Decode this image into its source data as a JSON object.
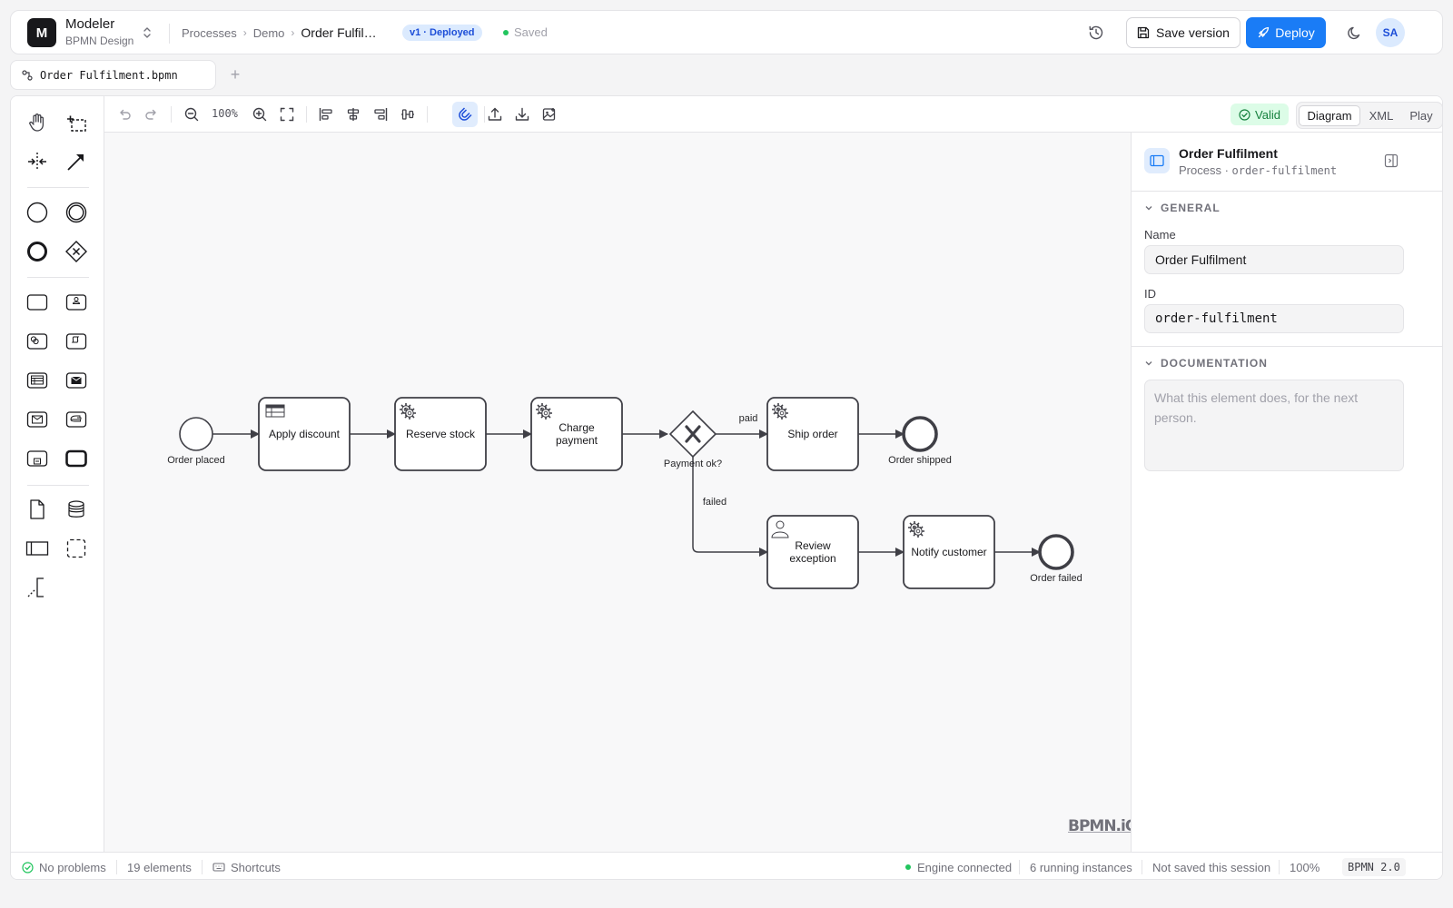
{
  "app": {
    "logo_letter": "M",
    "name": "Modeler",
    "subtitle": "BPMN Design"
  },
  "breadcrumb": [
    "Processes",
    "Demo",
    "Order Fulfil…"
  ],
  "version_badge": "v1 · Deployed",
  "save_state": "Saved",
  "header_actions": {
    "save_version": "Save version",
    "deploy": "Deploy",
    "avatar": "SA"
  },
  "tabs": [
    {
      "label": "Order Fulfilment.bpmn",
      "icon": "process-icon"
    }
  ],
  "add_tab": "+",
  "toolbar": {
    "zoom": "100%",
    "valid": "Valid",
    "views": [
      "Diagram",
      "XML",
      "Play"
    ],
    "active_view": "Diagram"
  },
  "palette": {
    "tools": [
      "hand-tool",
      "lasso-tool",
      "space-tool",
      "connect-tool"
    ],
    "events": [
      "start-event",
      "intermediate-event",
      "end-event",
      "gateway"
    ],
    "tasks": [
      "task",
      "user-task",
      "service-task",
      "script-task",
      "business-rule-task",
      "send-task",
      "receive-task",
      "manual-task",
      "subprocess",
      "call-activity"
    ],
    "data": [
      "data-object",
      "data-store",
      "pool",
      "group",
      "annotation"
    ]
  },
  "diagram": {
    "nodes": [
      {
        "id": "start",
        "type": "start-event",
        "label": "Order placed"
      },
      {
        "id": "discount",
        "type": "business-rule-task",
        "label": "Apply discount"
      },
      {
        "id": "reserve",
        "type": "service-task",
        "label": "Reserve stock"
      },
      {
        "id": "charge",
        "type": "service-task",
        "label": "Charge payment"
      },
      {
        "id": "gw",
        "type": "exclusive-gateway",
        "label": "Payment ok?"
      },
      {
        "id": "ship",
        "type": "service-task",
        "label": "Ship order"
      },
      {
        "id": "end_shipped",
        "type": "end-event",
        "label": "Order shipped"
      },
      {
        "id": "review",
        "type": "user-task",
        "label": "Review exception"
      },
      {
        "id": "notify",
        "type": "service-task",
        "label": "Notify customer"
      },
      {
        "id": "end_failed",
        "type": "end-event",
        "label": "Order failed"
      }
    ],
    "flows": [
      {
        "from": "start",
        "to": "discount",
        "label": ""
      },
      {
        "from": "discount",
        "to": "reserve",
        "label": ""
      },
      {
        "from": "reserve",
        "to": "charge",
        "label": ""
      },
      {
        "from": "charge",
        "to": "gw",
        "label": ""
      },
      {
        "from": "gw",
        "to": "ship",
        "label": "paid"
      },
      {
        "from": "ship",
        "to": "end_shipped",
        "label": ""
      },
      {
        "from": "gw",
        "to": "review",
        "label": "failed"
      },
      {
        "from": "review",
        "to": "notify",
        "label": ""
      },
      {
        "from": "notify",
        "to": "end_failed",
        "label": ""
      }
    ]
  },
  "watermark": "BPMN.iO",
  "properties": {
    "title": "Order Fulfilment",
    "type": "Process",
    "sep": " · ",
    "element_id": "order-fulfilment",
    "general_section": "GENERAL",
    "name_label": "Name",
    "name_value": "Order Fulfilment",
    "id_label": "ID",
    "id_value": "order-fulfilment",
    "doc_section": "DOCUMENTATION",
    "doc_placeholder": "What this element does, for the next person."
  },
  "status": {
    "problems": "No problems",
    "elements": "19 elements",
    "shortcuts": "Shortcuts",
    "engine": "Engine connected",
    "instances": "6 running instances",
    "session": "Not saved this session",
    "zoom": "100%",
    "notation": "BPMN 2.0"
  },
  "colors": {
    "accent": "#1a7cf6",
    "success": "#22c55e",
    "canvas": "#f8f8f9",
    "shape_stroke": "#3f3f46"
  }
}
